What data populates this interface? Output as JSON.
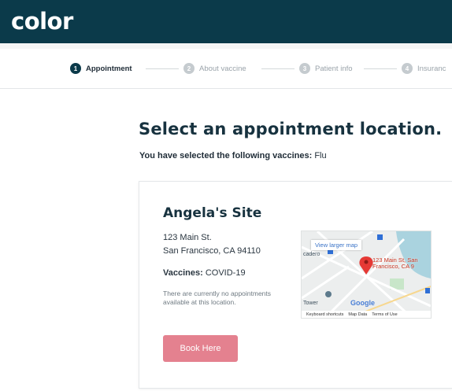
{
  "brand": {
    "logo_text": "color"
  },
  "stepper": {
    "steps": [
      {
        "number": "1",
        "label": "Appointment"
      },
      {
        "number": "2",
        "label": "About vaccine"
      },
      {
        "number": "3",
        "label": "Patient info"
      },
      {
        "number": "4",
        "label": "Insuranc"
      }
    ]
  },
  "page": {
    "title": "Select an appointment location.",
    "subtitle_prefix": "You have selected the following vaccines:",
    "subtitle_value": "Flu"
  },
  "location": {
    "name": "Angela's Site",
    "address_line1": "123 Main St.",
    "address_line2": "San Francisco, CA 94110",
    "vaccines_label": "Vaccines:",
    "vaccines_value": "COVID-19",
    "availability_note": "There are currently no appointments available at this location.",
    "book_label": "Book Here"
  },
  "map": {
    "larger_map_label": "View larger map",
    "pin_label": "123 Main St, San Francisco, CA 9",
    "area_label": "cadero",
    "tower_label": "Tower",
    "google_label": "Google",
    "footer_shortcuts": "Keyboard shortcuts",
    "footer_data": "Map Data",
    "footer_terms": "Terms of Use"
  },
  "colors": {
    "header_bg": "#0b3a4a",
    "accent_button": "#e4818f",
    "pin": "#e53935"
  }
}
